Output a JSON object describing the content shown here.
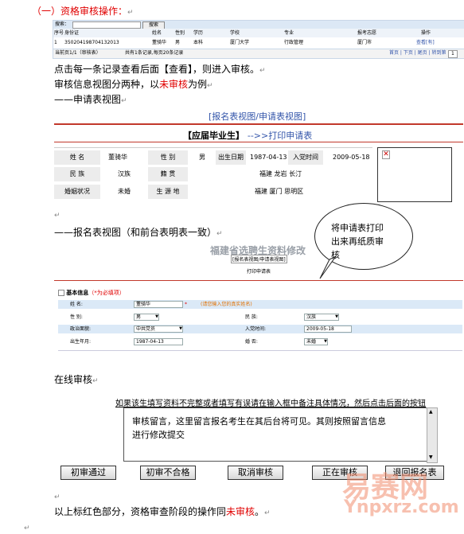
{
  "heading": "（一）资格审核操作：",
  "shot1": {
    "search_label": "搜索：",
    "search_button": "搜索",
    "columns": [
      "序号",
      "身份证",
      "姓名",
      "性别",
      "学历",
      "学校",
      "专业",
      "报考志愿",
      "操作"
    ],
    "row": [
      "1",
      "350204198704132013",
      "董骑华",
      "男",
      "本科",
      "厦门大学",
      "行政管理",
      "厦门市",
      "查看[有]"
    ],
    "footer_left": "当前页1/1（审核表）",
    "footer_mid": "共有1条记录,每页20条记录",
    "footer_right": "首页 | 下页 | 尾页 | 转到第",
    "page_select": "1"
  },
  "para1": "点击每一条记录查看后面【查看】，则进入审核。",
  "para2_prefix": "审核信息视图分两种，以",
  "para2_red": "未审核",
  "para2_suffix": "为例",
  "para3": "——申请表视图",
  "shot2": {
    "tabs_link": "[报名表视图/申请表视图]",
    "title_left": "【应届毕业生】",
    "title_right": "-->>打印申请表",
    "rows": [
      [
        "姓    名",
        "董骑华",
        "性    别",
        "男",
        "出生日期",
        "1987-04-13",
        "入党时间",
        "2009-05-18"
      ],
      [
        "民    族",
        "汉族",
        "籍    贯",
        "福建 龙岩 长汀"
      ],
      [
        "婚姻状况",
        "未婚",
        "生 源 地",
        "福建 厦门 思明区"
      ]
    ]
  },
  "para4": "——报名表视图（和前台表明表一致）",
  "callout": [
    "将申请表打印",
    "出来再纸质审",
    "核"
  ],
  "shot3": {
    "title": "福建省选聘生资料修改",
    "tabs_link": "[报名表视图/申请表视图]",
    "print_link": "打印申请表",
    "section": "基本信息",
    "section_note": "（*为必填项）",
    "fields": {
      "name_label": "姓      名:",
      "name_value": "董骑华",
      "name_hint": "(请您输入您的真实姓名)",
      "gender_label": "性      别:",
      "gender_value": "男",
      "ethnic_label": "民      族:",
      "ethnic_value": "汉族",
      "politics_label": "政治面貌:",
      "politics_value": "中共党员",
      "join_label": "入党时间:",
      "join_value": "2009-05-18",
      "birth_label": "出生年月:",
      "birth_value": "1987-04-13",
      "marriage_label": "婚      否:",
      "marriage_value": "未婚"
    }
  },
  "para5": "在线审核",
  "review": {
    "instruction": "如果该生填写资料不完整或者填写有误请在输入框中备注具体情况，然后点击后面的按钮",
    "box_line1": "审核留言，这里留言报名考生在其后台将可见。其则按照留言信息",
    "box_line2": "进行修改提交"
  },
  "buttons": [
    "初审通过",
    "初审不合格",
    "取消审核",
    "正在审核",
    "退回报名表"
  ],
  "para6_prefix": "以上标红色部分，资格审查阶段的操作同",
  "para6_red": "未审核",
  "para6_suffix": "。",
  "watermark": {
    "cn": "易赛网",
    "en": "Ynpxrz.com"
  },
  "colors": {
    "accent_red": "#e00000",
    "link_blue": "#3355aa",
    "band_blue": "#dbe9f7"
  }
}
